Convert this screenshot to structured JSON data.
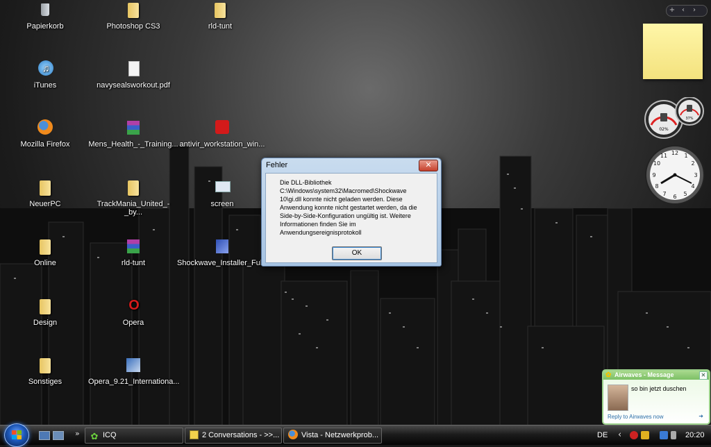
{
  "desktop": {
    "icons": [
      {
        "label": "Papierkorb",
        "icon": "recycle-bin-icon"
      },
      {
        "label": "Photoshop CS3",
        "icon": "folder-icon"
      },
      {
        "label": "rld-tunt",
        "icon": "folder-icon"
      },
      {
        "label": "iTunes",
        "icon": "itunes-icon"
      },
      {
        "label": "navysealsworkout.pdf",
        "icon": "document-icon"
      },
      {
        "label": "Mozilla Firefox",
        "icon": "firefox-icon"
      },
      {
        "label": "Mens_Health_-_Training...",
        "icon": "winrar-archive-icon"
      },
      {
        "label": "antivir_workstation_win...",
        "icon": "avira-icon"
      },
      {
        "label": "NeuerPC",
        "icon": "folder-icon"
      },
      {
        "label": "TrackMania_United_-_by...",
        "icon": "folder-icon"
      },
      {
        "label": "screen",
        "icon": "image-file-icon"
      },
      {
        "label": "Online",
        "icon": "folder-icon"
      },
      {
        "label": "rld-tunt",
        "icon": "winrar-archive-icon"
      },
      {
        "label": "Shockwave_Installer_Full...",
        "icon": "installer-icon"
      },
      {
        "label": "Design",
        "icon": "folder-icon"
      },
      {
        "label": "Opera",
        "icon": "opera-icon"
      },
      {
        "label": "Sonstiges",
        "icon": "folder-icon"
      },
      {
        "label": "Opera_9.21_Internationa...",
        "icon": "installer-icon"
      }
    ]
  },
  "dialog": {
    "title": "Fehler",
    "close_label": "✕",
    "message": "Die DLL-Bibliothek\nC:\\Windows\\system32\\Macromed\\Shockwave\n10\\gi.dll konnte nicht geladen werden. Diese\nAnwendung konnte nicht gestartet werden, da die\nSide-by-Side-Konfiguration ungültig ist. Weitere\nInformationen finden Sie im\nAnwendungsereignisprotokoll",
    "ok_label": "OK"
  },
  "sidebar": {
    "controls": [
      "+",
      "‹",
      "›"
    ],
    "meter_cpu": "02%",
    "meter_ram": "37%"
  },
  "icq_popup": {
    "title": "Airwaves - Message",
    "message": "so bin jetzt duschen",
    "reply": "Reply to Airwaves now"
  },
  "taskbar": {
    "quicklaunch_more": "»",
    "tasks": [
      {
        "label": "ICQ",
        "icon": "icq-icon"
      },
      {
        "label": "2 Conversations - >>...",
        "icon": "conversation-icon"
      },
      {
        "label": "Vista - Netzwerkprob...",
        "icon": "firefox-icon"
      }
    ],
    "language": "DE",
    "clock": "20:20"
  },
  "colors": {
    "dialog_frame": "#a6c3e2",
    "close_button": "#c6402c",
    "icq_green": "#7cc065",
    "taskbar": "#1c1c1c"
  }
}
